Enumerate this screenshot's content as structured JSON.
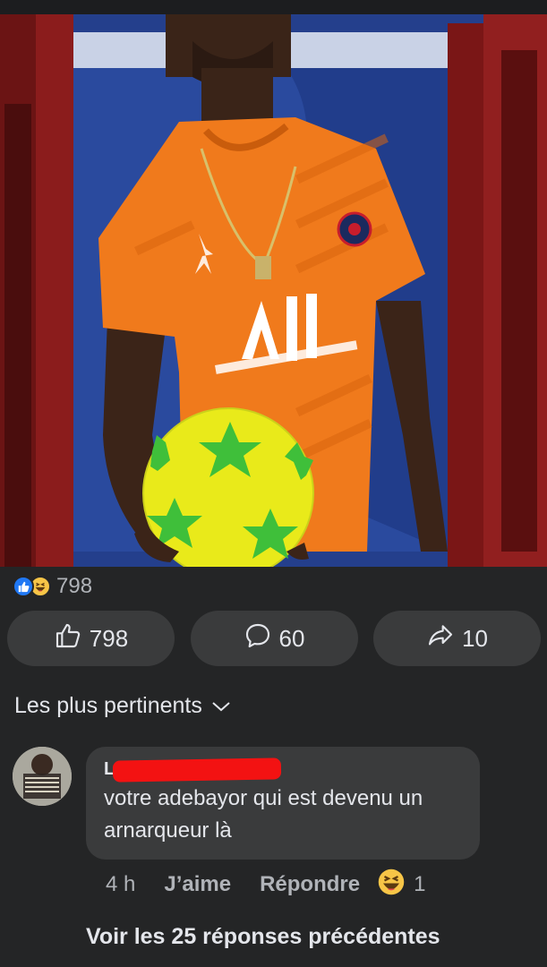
{
  "post": {
    "reaction_icons": [
      "like-icon",
      "haha-icon"
    ],
    "reaction_total": "798"
  },
  "actions": {
    "like_count": "798",
    "comment_count": "60",
    "share_count": "10"
  },
  "comments_sort": {
    "label": "Les plus pertinents"
  },
  "comment": {
    "author_visible_initial": "L",
    "text": "votre adebayor qui est devenu un arnarqueur là",
    "time": "4 h",
    "like_label": "J’aime",
    "reply_label": "Répondre",
    "reaction_count": "1"
  },
  "replies": {
    "see_previous_label": "Voir les 25 réponses précédentes"
  },
  "colors": {
    "background": "#242526",
    "button": "#3a3b3c",
    "text_primary": "#e4e6eb",
    "text_secondary": "#b0b3b8",
    "like_blue": "#2078f4",
    "haha_yellow": "#f7c547",
    "redaction_red": "#f31212"
  }
}
